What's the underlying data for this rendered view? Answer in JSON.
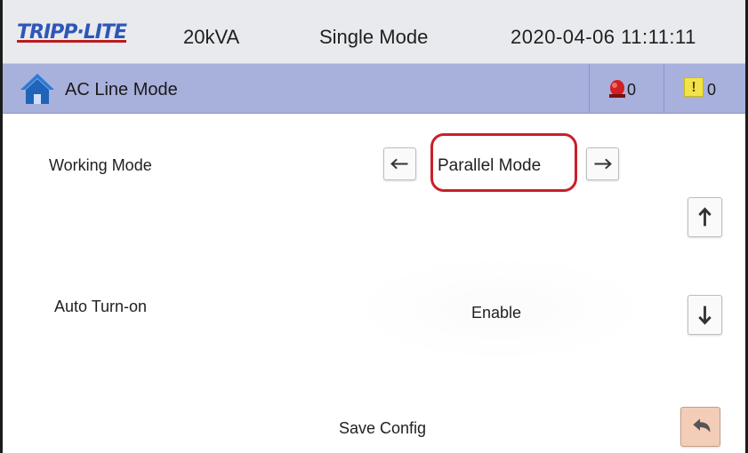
{
  "header": {
    "logo_text": "TRIPP·LITE",
    "capacity": "20kVA",
    "mode": "Single Mode",
    "datetime": "2020-04-06 11:11:11"
  },
  "titlebar": {
    "title": "AC Line Mode",
    "home_icon": "home-icon",
    "alarm_icon": "alarm-siren-icon",
    "alarm_count": "0",
    "warning_icon": "warning-icon",
    "warning_glyph": "!",
    "warning_count": "0"
  },
  "settings": {
    "working_mode_label": "Working Mode",
    "working_mode_value": "Parallel Mode",
    "auto_turn_on_label": "Auto Turn-on",
    "auto_turn_on_value": "Enable",
    "save_label": "Save Config"
  },
  "colors": {
    "titlebar": "#a8b0dc",
    "topbar": "#e9eaee",
    "highlight": "#c8202a",
    "back_button": "#f4cdb8",
    "logo_blue": "#2d57b8"
  }
}
